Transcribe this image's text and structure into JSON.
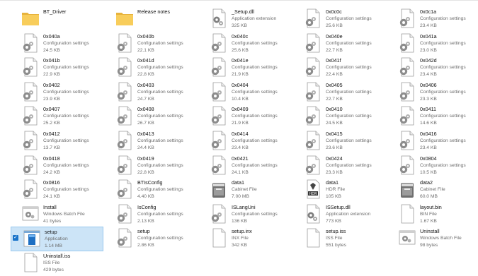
{
  "files": [
    {
      "name": "BT_Driver",
      "type": "",
      "size": "",
      "icon": "folder-icon"
    },
    {
      "name": "Release notes",
      "type": "",
      "size": "",
      "icon": "folder-icon"
    },
    {
      "name": "_Setup.dll",
      "type": "Application extension",
      "size": "325 KB",
      "icon": "dll-file-icon"
    },
    {
      "name": "0x0c0c",
      "type": "Configuration settings",
      "size": "25.6 KB",
      "icon": "config-file-icon"
    },
    {
      "name": "0x0c1a",
      "type": "Configuration settings",
      "size": "23.4 KB",
      "icon": "config-file-icon"
    },
    {
      "name": "0x040a",
      "type": "Configuration settings",
      "size": "24.5 KB",
      "icon": "config-file-icon"
    },
    {
      "name": "0x040b",
      "type": "Configuration settings",
      "size": "22.1 KB",
      "icon": "config-file-icon"
    },
    {
      "name": "0x040c",
      "type": "Configuration settings",
      "size": "25.6 KB",
      "icon": "config-file-icon"
    },
    {
      "name": "0x040e",
      "type": "Configuration settings",
      "size": "22.7 KB",
      "icon": "config-file-icon"
    },
    {
      "name": "0x041a",
      "type": "Configuration settings",
      "size": "23.0 KB",
      "icon": "config-file-icon"
    },
    {
      "name": "0x041b",
      "type": "Configuration settings",
      "size": "22.9 KB",
      "icon": "config-file-icon"
    },
    {
      "name": "0x041d",
      "type": "Configuration settings",
      "size": "22.8 KB",
      "icon": "config-file-icon"
    },
    {
      "name": "0x041e",
      "type": "Configuration settings",
      "size": "21.9 KB",
      "icon": "config-file-icon"
    },
    {
      "name": "0x041f",
      "type": "Configuration settings",
      "size": "22.4 KB",
      "icon": "config-file-icon"
    },
    {
      "name": "0x042d",
      "type": "Configuration settings",
      "size": "23.4 KB",
      "icon": "config-file-icon"
    },
    {
      "name": "0x0402",
      "type": "Configuration settings",
      "size": "23.9 KB",
      "icon": "config-file-icon"
    },
    {
      "name": "0x0403",
      "type": "Configuration settings",
      "size": "24.7 KB",
      "icon": "config-file-icon"
    },
    {
      "name": "0x0404",
      "type": "Configuration settings",
      "size": "10.4 KB",
      "icon": "config-file-icon"
    },
    {
      "name": "0x0405",
      "type": "Configuration settings",
      "size": "22.7 KB",
      "icon": "config-file-icon"
    },
    {
      "name": "0x0406",
      "type": "Configuration settings",
      "size": "23.3 KB",
      "icon": "config-file-icon"
    },
    {
      "name": "0x0407",
      "type": "Configuration settings",
      "size": "25.2 KB",
      "icon": "config-file-icon"
    },
    {
      "name": "0x0408",
      "type": "Configuration settings",
      "size": "26.7 KB",
      "icon": "config-file-icon"
    },
    {
      "name": "0x0409",
      "type": "Configuration settings",
      "size": "21.9 KB",
      "icon": "config-file-icon"
    },
    {
      "name": "0x0410",
      "type": "Configuration settings",
      "size": "24.5 KB",
      "icon": "config-file-icon"
    },
    {
      "name": "0x0411",
      "type": "Configuration settings",
      "size": "14.6 KB",
      "icon": "config-file-icon"
    },
    {
      "name": "0x0412",
      "type": "Configuration settings",
      "size": "13.7 KB",
      "icon": "config-file-icon"
    },
    {
      "name": "0x0413",
      "type": "Configuration settings",
      "size": "24.4 KB",
      "icon": "config-file-icon"
    },
    {
      "name": "0x0414",
      "type": "Configuration settings",
      "size": "23.4 KB",
      "icon": "config-file-icon"
    },
    {
      "name": "0x0415",
      "type": "Configuration settings",
      "size": "23.6 KB",
      "icon": "config-file-icon"
    },
    {
      "name": "0x0416",
      "type": "Configuration settings",
      "size": "23.4 KB",
      "icon": "config-file-icon"
    },
    {
      "name": "0x0418",
      "type": "Configuration settings",
      "size": "24.2 KB",
      "icon": "config-file-icon"
    },
    {
      "name": "0x0419",
      "type": "Configuration settings",
      "size": "22.8 KB",
      "icon": "config-file-icon"
    },
    {
      "name": "0x0421",
      "type": "Configuration settings",
      "size": "24.1 KB",
      "icon": "config-file-icon"
    },
    {
      "name": "0x0424",
      "type": "Configuration settings",
      "size": "23.3 KB",
      "icon": "config-file-icon"
    },
    {
      "name": "0x0804",
      "type": "Configuration settings",
      "size": "10.5 KB",
      "icon": "config-file-icon"
    },
    {
      "name": "0x0816",
      "type": "Configuration settings",
      "size": "24.1 KB",
      "icon": "config-file-icon"
    },
    {
      "name": "BTIsConfig",
      "type": "Configuration settings",
      "size": "4.40 KB",
      "icon": "config-file-icon"
    },
    {
      "name": "data1",
      "type": "Cabinet File",
      "size": "7.00 MB",
      "icon": "cabinet-file-icon"
    },
    {
      "name": "data1",
      "type": "HDR File",
      "size": "105 KB",
      "icon": "hdr-file-icon"
    },
    {
      "name": "data2",
      "type": "Cabinet File",
      "size": "60.0 MB",
      "icon": "cabinet-file-icon"
    },
    {
      "name": "Install",
      "type": "Windows Batch File",
      "size": "41 bytes",
      "icon": "batch-file-icon"
    },
    {
      "name": "IsConfig",
      "type": "Configuration settings",
      "size": "2.13 KB",
      "icon": "config-file-icon"
    },
    {
      "name": "ISLangUni",
      "type": "Configuration settings",
      "size": "136 KB",
      "icon": "config-file-icon"
    },
    {
      "name": "ISSetup.dll",
      "type": "Application extension",
      "size": "773 KB",
      "icon": "dll-file-icon"
    },
    {
      "name": "layout.bin",
      "type": "BIN File",
      "size": "1.67 KB",
      "icon": "blank-file-icon"
    },
    {
      "name": "setup",
      "type": "Application",
      "size": "1.14 MB",
      "icon": "application-icon",
      "selected": true
    },
    {
      "name": "setup",
      "type": "Configuration settings",
      "size": "2.86 KB",
      "icon": "config-file-icon"
    },
    {
      "name": "setup.inx",
      "type": "INX File",
      "size": "342 KB",
      "icon": "blank-file-icon"
    },
    {
      "name": "setup.iss",
      "type": "ISS File",
      "size": "551 bytes",
      "icon": "blank-file-icon"
    },
    {
      "name": "Uninstall",
      "type": "Windows Batch File",
      "size": "98 bytes",
      "icon": "batch-file-icon"
    },
    {
      "name": "Uninstall.iss",
      "type": "ISS File",
      "size": "429 bytes",
      "icon": "blank-file-icon"
    }
  ],
  "colors": {
    "selection": "#cce4f7",
    "folder": "#f4c64f",
    "accent": "#1a73c9"
  }
}
